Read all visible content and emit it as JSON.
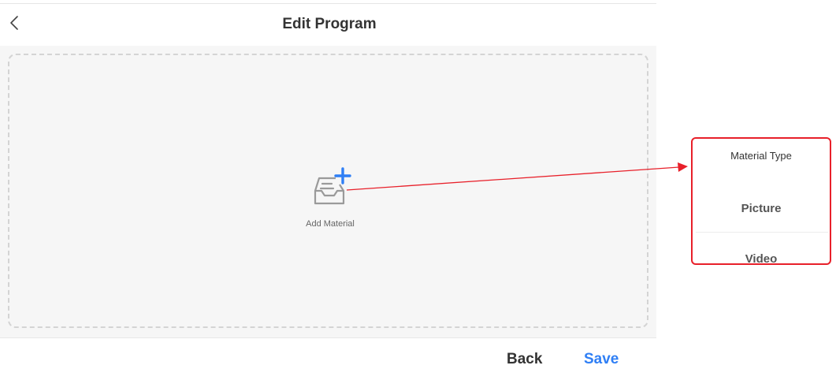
{
  "header": {
    "title": "Edit Program",
    "back_icon": "chevron-left-icon"
  },
  "main": {
    "add_material_label": "Add Material",
    "add_material_icon": "inbox-plus-icon"
  },
  "footer": {
    "back_label": "Back",
    "save_label": "Save"
  },
  "popup": {
    "title": "Material Type",
    "options": [
      {
        "label": "Picture"
      },
      {
        "label": "Video"
      }
    ]
  },
  "colors": {
    "accent": "#2f7ff5",
    "annotation": "#e8202a"
  }
}
